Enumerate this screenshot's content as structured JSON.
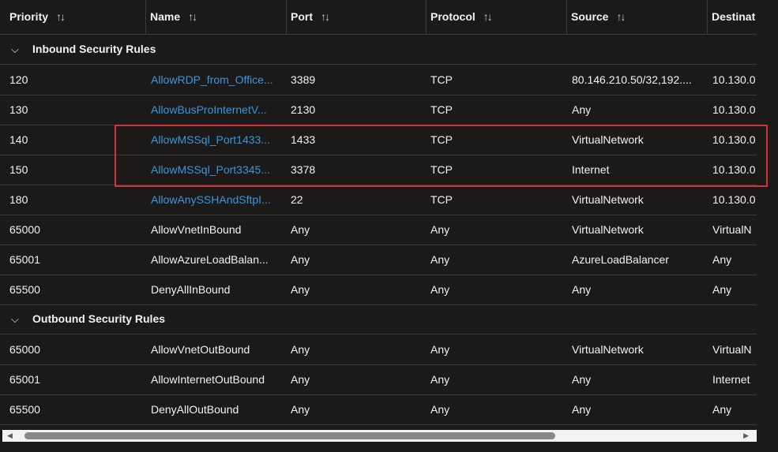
{
  "columns": [
    {
      "label": "Priority"
    },
    {
      "label": "Name"
    },
    {
      "label": "Port"
    },
    {
      "label": "Protocol"
    },
    {
      "label": "Source"
    },
    {
      "label": "Destinat"
    }
  ],
  "sort_glyph": "↑↓",
  "groups": [
    {
      "label": "Inbound Security Rules",
      "rows": [
        {
          "priority": "120",
          "name": "AllowRDP_from_Office...",
          "port": "3389",
          "protocol": "TCP",
          "source": "80.146.210.50/32,192....",
          "destination": "10.130.0",
          "name_is_link": true
        },
        {
          "priority": "130",
          "name": "AllowBusProInternetV...",
          "port": "2130",
          "protocol": "TCP",
          "source": "Any",
          "destination": "10.130.0",
          "name_is_link": true
        },
        {
          "priority": "140",
          "name": "AllowMSSql_Port1433...",
          "port": "1433",
          "protocol": "TCP",
          "source": "VirtualNetwork",
          "destination": "10.130.0",
          "name_is_link": true
        },
        {
          "priority": "150",
          "name": "AllowMSSql_Port3345...",
          "port": "3378",
          "protocol": "TCP",
          "source": "Internet",
          "destination": "10.130.0",
          "name_is_link": true
        },
        {
          "priority": "180",
          "name": "AllowAnySSHAndSftpI...",
          "port": "22",
          "protocol": "TCP",
          "source": "VirtualNetwork",
          "destination": "10.130.0",
          "name_is_link": true
        },
        {
          "priority": "65000",
          "name": "AllowVnetInBound",
          "port": "Any",
          "protocol": "Any",
          "source": "VirtualNetwork",
          "destination": "VirtualN",
          "name_is_link": false
        },
        {
          "priority": "65001",
          "name": "AllowAzureLoadBalan...",
          "port": "Any",
          "protocol": "Any",
          "source": "AzureLoadBalancer",
          "destination": "Any",
          "name_is_link": false
        },
        {
          "priority": "65500",
          "name": "DenyAllInBound",
          "port": "Any",
          "protocol": "Any",
          "source": "Any",
          "destination": "Any",
          "name_is_link": false
        }
      ]
    },
    {
      "label": "Outbound Security Rules",
      "rows": [
        {
          "priority": "65000",
          "name": "AllowVnetOutBound",
          "port": "Any",
          "protocol": "Any",
          "source": "VirtualNetwork",
          "destination": "VirtualN",
          "name_is_link": false
        },
        {
          "priority": "65001",
          "name": "AllowInternetOutBound",
          "port": "Any",
          "protocol": "Any",
          "source": "Any",
          "destination": "Internet",
          "name_is_link": false
        },
        {
          "priority": "65500",
          "name": "DenyAllOutBound",
          "port": "Any",
          "protocol": "Any",
          "source": "Any",
          "destination": "Any",
          "name_is_link": false
        }
      ]
    }
  ],
  "colors": {
    "link": "#3a96dd",
    "highlight": "#d13438",
    "background": "#1b1a19"
  }
}
